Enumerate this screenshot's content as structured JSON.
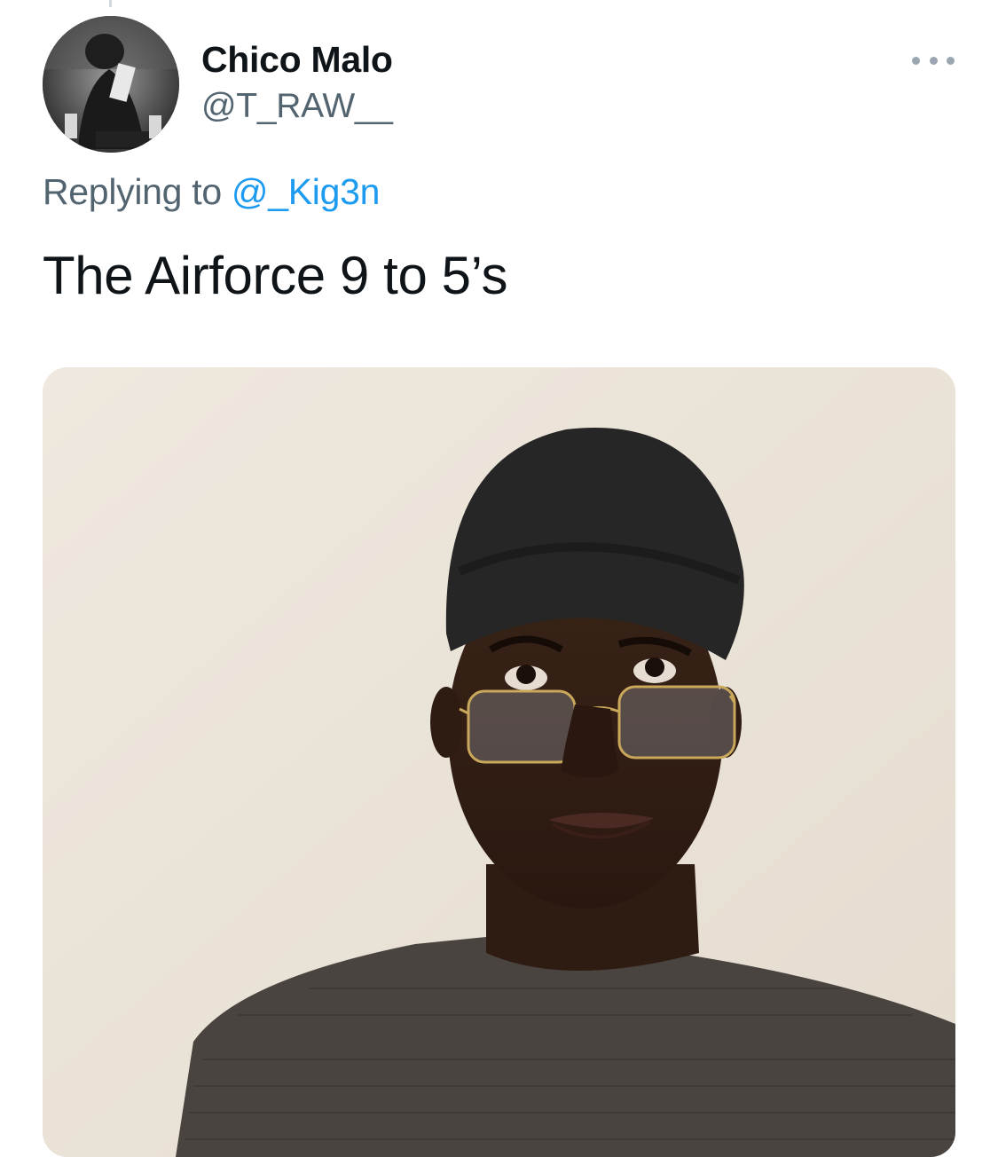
{
  "tweet": {
    "author": {
      "display_name": "Chico Malo",
      "handle": "@T_RAW__",
      "avatar_icon": "user-avatar-photo"
    },
    "more_icon": "more-horizontal-icon",
    "reply_context": {
      "prefix": "Replying to",
      "mention": "@_Kig3n"
    },
    "text": "The Airforce 9 to 5’s",
    "media": {
      "type": "photo"
    }
  },
  "colors": {
    "primary_text": "#0f1419",
    "secondary_text": "#536471",
    "link": "#1d9bf0",
    "photo_background": "#ece6dc"
  }
}
